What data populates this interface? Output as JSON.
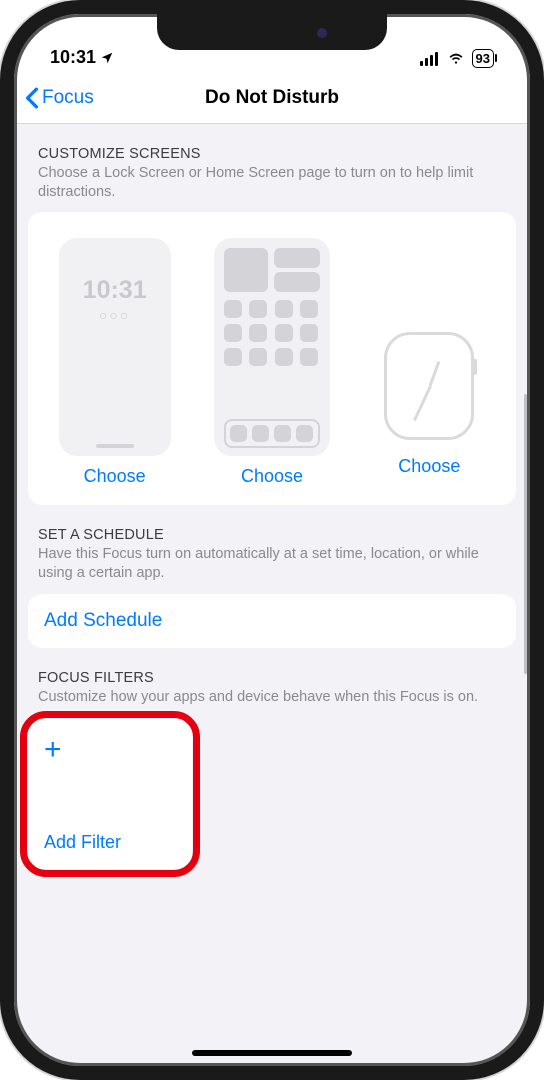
{
  "status": {
    "time": "10:31",
    "battery": "93"
  },
  "nav": {
    "back": "Focus",
    "title": "Do Not Disturb"
  },
  "customize": {
    "title": "CUSTOMIZE SCREENS",
    "subtitle": "Choose a Lock Screen or Home Screen page to turn on to help limit distractions.",
    "lock_time": "10:31",
    "lock_dots": "○○○",
    "choose": "Choose"
  },
  "schedule": {
    "title": "SET A SCHEDULE",
    "subtitle": "Have this Focus turn on automatically at a set time, location, or while using a certain app.",
    "add": "Add Schedule"
  },
  "filters": {
    "title": "FOCUS FILTERS",
    "subtitle": "Customize how your apps and device behave when this Focus is on.",
    "plus": "+",
    "add": "Add Filter"
  }
}
